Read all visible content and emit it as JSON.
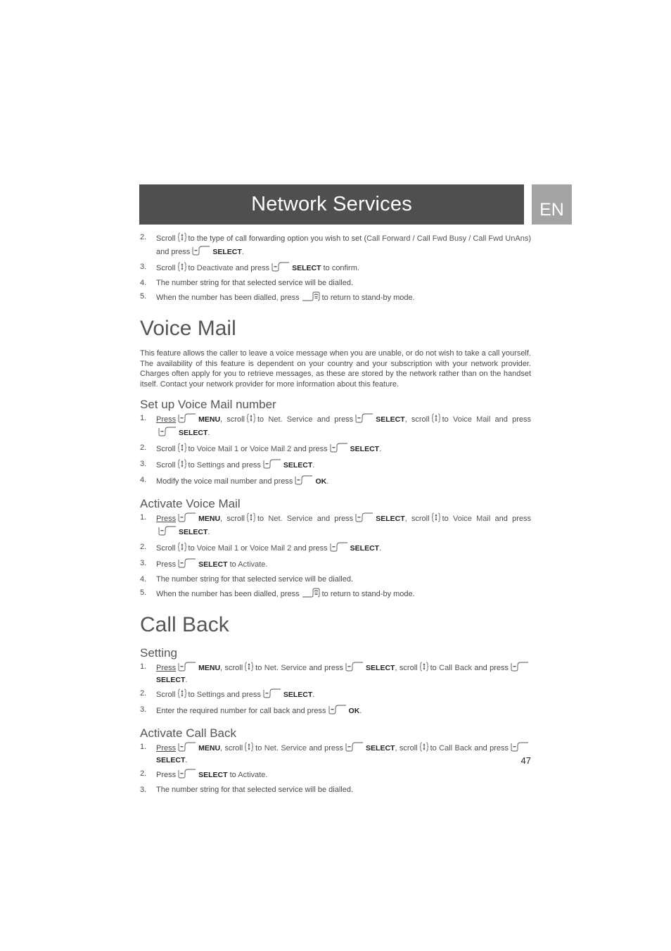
{
  "header": {
    "title": "Network Services",
    "language": "EN"
  },
  "intro_steps": [
    {
      "num": "2.",
      "parts": [
        [
          "t",
          "Scroll"
        ],
        [
          "scroll"
        ],
        [
          "t",
          "to the type of call forwarding option you wish to set ("
        ],
        [
          "k",
          "Call Forward / Call Fwd Busy / Call Fwd UnAns"
        ],
        [
          "t",
          ") and press"
        ],
        [
          "soft"
        ],
        [
          "b",
          "SELECT"
        ],
        [
          "t",
          "."
        ]
      ]
    },
    {
      "num": "3.",
      "parts": [
        [
          "t",
          "Scroll"
        ],
        [
          "scroll"
        ],
        [
          "t",
          "to "
        ],
        [
          "k",
          "Deactivate"
        ],
        [
          "t",
          " and press"
        ],
        [
          "soft"
        ],
        [
          "b",
          "SELECT"
        ],
        [
          "t",
          " to confirm."
        ]
      ]
    },
    {
      "num": "4.",
      "parts": [
        [
          "t",
          "The number string for that selected service will be dialled."
        ]
      ]
    },
    {
      "num": "5.",
      "parts": [
        [
          "t",
          "When the number has been dialled, press"
        ],
        [
          "end"
        ],
        [
          "t",
          "to return to stand-by mode."
        ]
      ]
    }
  ],
  "voice_mail": {
    "title": "Voice Mail",
    "description": "This feature allows the caller to leave a voice message when you are unable, or do not wish to take a call yourself. The availability of this feature is dependent on your country and your subscription with your network provider. Charges often apply for you to retrieve messages, as these are stored by the network rather than on the handset itself. Contact your network provider for more information about this feature.",
    "setup": {
      "title": "Set up Voice Mail number",
      "steps": [
        {
          "num": "1.",
          "parts": [
            [
              "u",
              "Press"
            ],
            [
              "soft"
            ],
            [
              "b",
              "MENU"
            ],
            [
              "t",
              ", scroll"
            ],
            [
              "scroll"
            ],
            [
              "t",
              "to "
            ],
            [
              "k",
              "Net. Service"
            ],
            [
              "t",
              " and press"
            ],
            [
              "soft"
            ],
            [
              "b",
              "SELECT"
            ],
            [
              "t",
              ", scroll"
            ],
            [
              "scroll"
            ],
            [
              "t",
              "to "
            ],
            [
              "k",
              "Voice Mail"
            ],
            [
              "t",
              " and press"
            ],
            [
              "soft"
            ],
            [
              "b",
              "SELECT"
            ],
            [
              "t",
              "."
            ]
          ]
        },
        {
          "num": "2.",
          "parts": [
            [
              "t",
              "Scroll"
            ],
            [
              "scroll"
            ],
            [
              "t",
              "to "
            ],
            [
              "k",
              "Voice Mail 1"
            ],
            [
              "t",
              " or "
            ],
            [
              "k",
              "Voice Mail 2"
            ],
            [
              "t",
              " and press"
            ],
            [
              "soft"
            ],
            [
              "b",
              "SELECT"
            ],
            [
              "t",
              "."
            ]
          ]
        },
        {
          "num": "3.",
          "parts": [
            [
              "t",
              "Scroll"
            ],
            [
              "scroll"
            ],
            [
              "t",
              "to "
            ],
            [
              "k",
              "Settings"
            ],
            [
              "t",
              " and press"
            ],
            [
              "soft"
            ],
            [
              "b",
              "SELECT"
            ],
            [
              "t",
              "."
            ]
          ]
        },
        {
          "num": "4.",
          "parts": [
            [
              "t",
              "Modify the voice mail number and press"
            ],
            [
              "soft"
            ],
            [
              "b",
              "OK"
            ],
            [
              "t",
              "."
            ]
          ]
        }
      ]
    },
    "activate": {
      "title": "Activate Voice Mail",
      "steps": [
        {
          "num": "1.",
          "parts": [
            [
              "u",
              "Press"
            ],
            [
              "soft"
            ],
            [
              "b",
              "MENU"
            ],
            [
              "t",
              ", scroll"
            ],
            [
              "scroll"
            ],
            [
              "t",
              "to "
            ],
            [
              "k",
              "Net. Service"
            ],
            [
              "t",
              " and press"
            ],
            [
              "soft"
            ],
            [
              "b",
              "SELECT"
            ],
            [
              "t",
              ", scroll"
            ],
            [
              "scroll"
            ],
            [
              "t",
              "to "
            ],
            [
              "k",
              "Voice Mail"
            ],
            [
              "t",
              " and press"
            ],
            [
              "soft"
            ],
            [
              "b",
              "SELECT"
            ],
            [
              "t",
              "."
            ]
          ]
        },
        {
          "num": "2.",
          "parts": [
            [
              "t",
              "Scroll"
            ],
            [
              "scroll"
            ],
            [
              "t",
              "to "
            ],
            [
              "k",
              "Voice Mail 1"
            ],
            [
              "t",
              " or "
            ],
            [
              "k",
              "Voice Mail 2"
            ],
            [
              "t",
              " and press"
            ],
            [
              "soft"
            ],
            [
              "b",
              "SELECT"
            ],
            [
              "t",
              "."
            ]
          ]
        },
        {
          "num": "3.",
          "parts": [
            [
              "t",
              "Press"
            ],
            [
              "soft"
            ],
            [
              "b",
              "SELECT"
            ],
            [
              "t",
              " to "
            ],
            [
              "k",
              "Activate"
            ],
            [
              "t",
              "."
            ]
          ]
        },
        {
          "num": "4.",
          "parts": [
            [
              "t",
              "The number string for that selected service will be dialled."
            ]
          ]
        },
        {
          "num": "5.",
          "parts": [
            [
              "t",
              "When the number has been dialled, press"
            ],
            [
              "end"
            ],
            [
              "t",
              "to return to stand-by mode."
            ]
          ]
        }
      ]
    }
  },
  "call_back": {
    "title": "Call Back",
    "setting": {
      "title": "Setting",
      "steps": [
        {
          "num": "1.",
          "parts": [
            [
              "u",
              "Press"
            ],
            [
              "soft"
            ],
            [
              "b",
              "MENU"
            ],
            [
              "t",
              ", scroll"
            ],
            [
              "scroll"
            ],
            [
              "t",
              "to "
            ],
            [
              "k",
              "Net. Service"
            ],
            [
              "t",
              " and press"
            ],
            [
              "soft"
            ],
            [
              "b",
              "SELECT"
            ],
            [
              "t",
              ", scroll"
            ],
            [
              "scroll"
            ],
            [
              "t",
              "to "
            ],
            [
              "k",
              "Call Back"
            ],
            [
              "t",
              " and press"
            ],
            [
              "soft"
            ],
            [
              "b",
              "SELECT"
            ],
            [
              "t",
              "."
            ]
          ]
        },
        {
          "num": "2.",
          "parts": [
            [
              "t",
              "Scroll"
            ],
            [
              "scroll"
            ],
            [
              "t",
              "to "
            ],
            [
              "k",
              "Settings"
            ],
            [
              "t",
              " and press"
            ],
            [
              "soft"
            ],
            [
              "b",
              "SELECT"
            ],
            [
              "t",
              "."
            ]
          ]
        },
        {
          "num": "3.",
          "parts": [
            [
              "t",
              "Enter the required number for call back and press"
            ],
            [
              "soft"
            ],
            [
              "b",
              "OK"
            ],
            [
              "t",
              "."
            ]
          ]
        }
      ]
    },
    "activate": {
      "title": "Activate Call Back",
      "steps": [
        {
          "num": "1.",
          "parts": [
            [
              "u",
              "Press"
            ],
            [
              "soft"
            ],
            [
              "b",
              "MENU"
            ],
            [
              "t",
              ", scroll"
            ],
            [
              "scroll"
            ],
            [
              "t",
              "to "
            ],
            [
              "k",
              "Net. Service"
            ],
            [
              "t",
              " and press"
            ],
            [
              "soft"
            ],
            [
              "b",
              "SELECT"
            ],
            [
              "t",
              ", scroll"
            ],
            [
              "scroll"
            ],
            [
              "t",
              "to "
            ],
            [
              "k",
              "Call Back"
            ],
            [
              "t",
              " and press"
            ],
            [
              "soft"
            ],
            [
              "b",
              "SELECT"
            ],
            [
              "t",
              "."
            ]
          ]
        },
        {
          "num": "2.",
          "parts": [
            [
              "t",
              "Press"
            ],
            [
              "soft"
            ],
            [
              "b",
              "SELECT"
            ],
            [
              "t",
              " to "
            ],
            [
              "k",
              "Activate"
            ],
            [
              "t",
              "."
            ]
          ]
        },
        {
          "num": "3.",
          "parts": [
            [
              "t",
              "The number string for that selected service will be dialled."
            ]
          ]
        }
      ]
    }
  },
  "page_number": "47",
  "icons": {
    "scroll": "scroll-key-icon",
    "soft": "softkey-icon",
    "end": "end-call-key-icon"
  }
}
